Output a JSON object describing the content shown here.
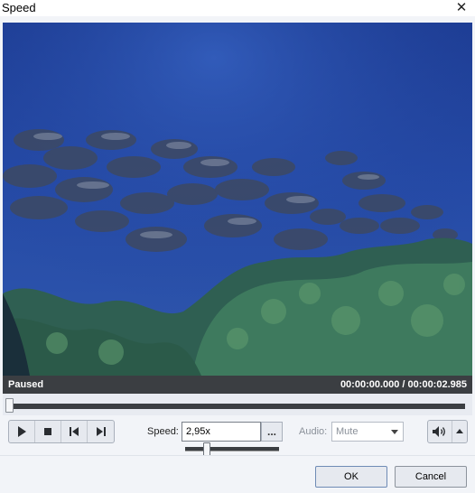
{
  "window": {
    "title": "Speed",
    "close_glyph": "✕"
  },
  "player": {
    "state": "Paused",
    "time_display": "00:00:00.000  /  00:00:02.985",
    "seek_position_fraction": 0.0
  },
  "controls": {
    "speed_label": "Speed:",
    "speed_value": "2,95x",
    "speed_more_label": "...",
    "speed_slider_fraction": 0.2,
    "audio_label": "Audio:",
    "audio_value": "Mute",
    "icons": [
      "play-icon",
      "stop-icon",
      "previous-frame-icon",
      "next-frame-icon",
      "speaker-icon",
      "volume-dropdown-icon"
    ]
  },
  "footer": {
    "ok_label": "OK",
    "cancel_label": "Cancel"
  }
}
